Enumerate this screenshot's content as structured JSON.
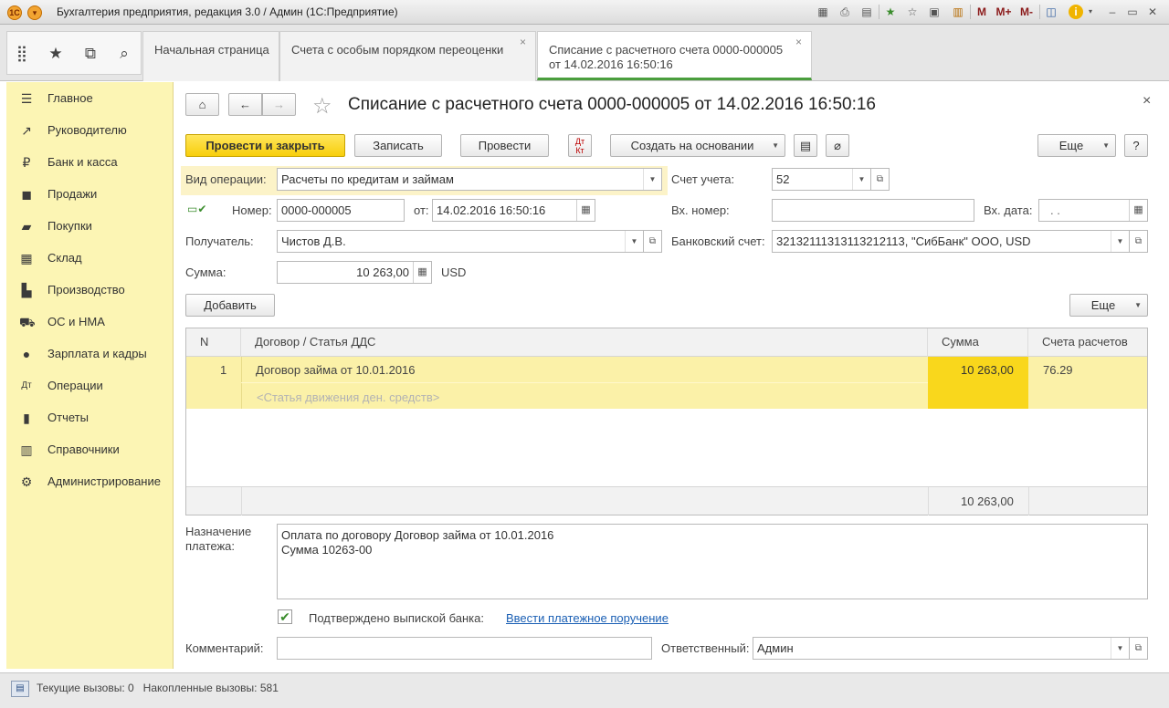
{
  "window": {
    "title": "Бухгалтерия предприятия, редакция 3.0 / Админ  (1С:Предприятие)",
    "toolbar_icons": [
      "save-icon",
      "print-icon",
      "preview-icon",
      "favorites-add-icon",
      "favorites-icon",
      "history-icon",
      "calculator-icon",
      "calendar-icon"
    ],
    "memory_labels": [
      "M",
      "M+",
      "M-"
    ],
    "info_label": "i"
  },
  "tabs": [
    {
      "label": "Начальная страница"
    },
    {
      "label": "Счета с особым порядком переоценки"
    },
    {
      "label_line1": "Списание с расчетного счета 0000-000005",
      "label_line2": "от 14.02.2016 16:50:16"
    }
  ],
  "sidebar": {
    "items": [
      {
        "label": "Главное",
        "icon": "menu-icon"
      },
      {
        "label": "Руководителю",
        "icon": "chart-trend-icon"
      },
      {
        "label": "Банк и касса",
        "icon": "coin-icon"
      },
      {
        "label": "Продажи",
        "icon": "bag-icon"
      },
      {
        "label": "Покупки",
        "icon": "cart-icon"
      },
      {
        "label": "Склад",
        "icon": "warehouse-icon"
      },
      {
        "label": "Производство",
        "icon": "factory-icon"
      },
      {
        "label": "ОС и НМА",
        "icon": "truck-icon"
      },
      {
        "label": "Зарплата и кадры",
        "icon": "person-icon"
      },
      {
        "label": "Операции",
        "icon": "dt-kt-icon"
      },
      {
        "label": "Отчеты",
        "icon": "bar-chart-icon"
      },
      {
        "label": "Справочники",
        "icon": "book-icon"
      },
      {
        "label": "Администрирование",
        "icon": "gear-icon"
      }
    ]
  },
  "doc": {
    "title": "Списание с расчетного счета 0000-000005 от 14.02.2016 16:50:16",
    "buttons": {
      "post_close": "Провести и закрыть",
      "write": "Записать",
      "post": "Провести",
      "create_based": "Создать на основании",
      "more": "Еще",
      "help": "?",
      "add": "Добавить",
      "more2": "Еще"
    },
    "fields": {
      "op_type_label": "Вид операции:",
      "op_type_value": "Расчеты по кредитам и займам",
      "account_label": "Счет учета:",
      "account_value": "52",
      "number_label": "Номер:",
      "number_value": "0000-000005",
      "from_label": "от:",
      "date_value": "14.02.2016 16:50:16",
      "in_number_label": "Вх. номер:",
      "in_number_value": "",
      "in_date_label": "Вх. дата:",
      "in_date_value": " .  .",
      "recipient_label": "Получатель:",
      "recipient_value": "Чистов Д.В.",
      "bank_account_label": "Банковский счет:",
      "bank_account_value": "32132111313113212113, \"СибБанк\" ООО, USD",
      "sum_label": "Сумма:",
      "sum_value": "10 263,00",
      "currency": "USD"
    },
    "table": {
      "headers": [
        "N",
        "Договор / Статья ДДС",
        "Сумма",
        "Счета расчетов"
      ],
      "rows": [
        {
          "n": "1",
          "contract": "Договор займа от 10.01.2016",
          "dds_placeholder": "<Статья движения ден. средств>",
          "sum": "10 263,00",
          "accounts": "76.29"
        }
      ],
      "total": "10 263,00"
    },
    "purpose_label_1": "Назначение",
    "purpose_label_2": "платежа:",
    "purpose_line1": "Оплата по договору Договор займа от 10.01.2016",
    "purpose_line2": "Сумма 10263-00",
    "confirmed_label": "Подтверждено выпиской банка:",
    "confirmed_checked": true,
    "payment_order_link": "Ввести платежное поручение",
    "comment_label": "Комментарий:",
    "comment_value": "",
    "responsible_label": "Ответственный:",
    "responsible_value": "Админ"
  },
  "status": {
    "text": "Текущие вызовы: 0   Накопленные вызовы: 581"
  },
  "colors": {
    "sidebar_bg": "#fcf5b4",
    "primary_button": "#f8cf0c",
    "row_highlight": "#fbf1a8",
    "sum_cell": "#f9d71c",
    "active_tab_underline": "#4a9e3d",
    "link": "#1a5fb4"
  }
}
